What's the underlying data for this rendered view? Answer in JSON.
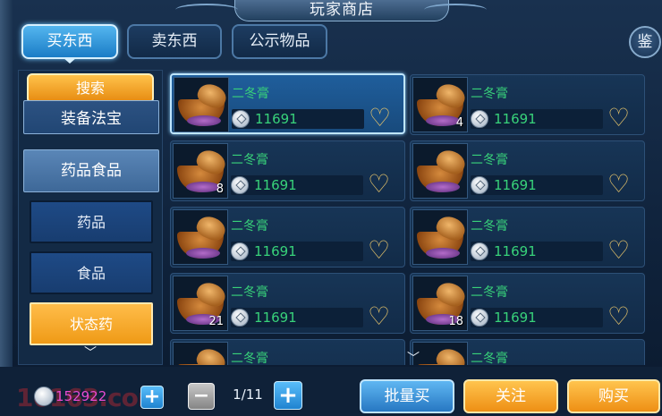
{
  "window": {
    "title": "玩家商店"
  },
  "tabs": [
    {
      "label": "买东西",
      "active": true
    },
    {
      "label": "卖东西",
      "active": false
    },
    {
      "label": "公示物品",
      "active": false
    }
  ],
  "identify_button": {
    "label": "鉴"
  },
  "sidebar": {
    "search_label": "搜索",
    "categories": [
      {
        "label": "装备法宝",
        "type": "major"
      },
      {
        "label": "药品食品",
        "type": "major"
      },
      {
        "label": "药品",
        "type": "minor"
      },
      {
        "label": "食品",
        "type": "minor"
      },
      {
        "label": "状态药",
        "type": "minor",
        "selected": true
      }
    ]
  },
  "items": [
    {
      "name": "二冬膏",
      "price": "11691",
      "qty": "",
      "selected": true
    },
    {
      "name": "二冬膏",
      "price": "11691",
      "qty": "4"
    },
    {
      "name": "二冬膏",
      "price": "11691",
      "qty": "8"
    },
    {
      "name": "二冬膏",
      "price": "11691",
      "qty": ""
    },
    {
      "name": "二冬膏",
      "price": "11691",
      "qty": ""
    },
    {
      "name": "二冬膏",
      "price": "11691",
      "qty": ""
    },
    {
      "name": "二冬膏",
      "price": "11691",
      "qty": "21"
    },
    {
      "name": "二冬膏",
      "price": "11691",
      "qty": "18"
    },
    {
      "name": "二冬膏",
      "price": "",
      "qty": ""
    },
    {
      "name": "二冬膏",
      "price": "",
      "qty": ""
    }
  ],
  "footer": {
    "wallet": "152922",
    "page": "1/11",
    "batch_buy_label": "批量买",
    "follow_label": "关注",
    "buy_label": "购买"
  },
  "watermark": "16163.com",
  "icons": {
    "coin": "silver-coin-icon",
    "favorite": "heart-outline-icon",
    "scroll": "chevron-down-icon"
  },
  "colors": {
    "price_green": "#38d27a",
    "wallet_magenta": "#e84bd2",
    "accent_blue": "#1a7cc6",
    "accent_orange": "#ee8f14"
  }
}
